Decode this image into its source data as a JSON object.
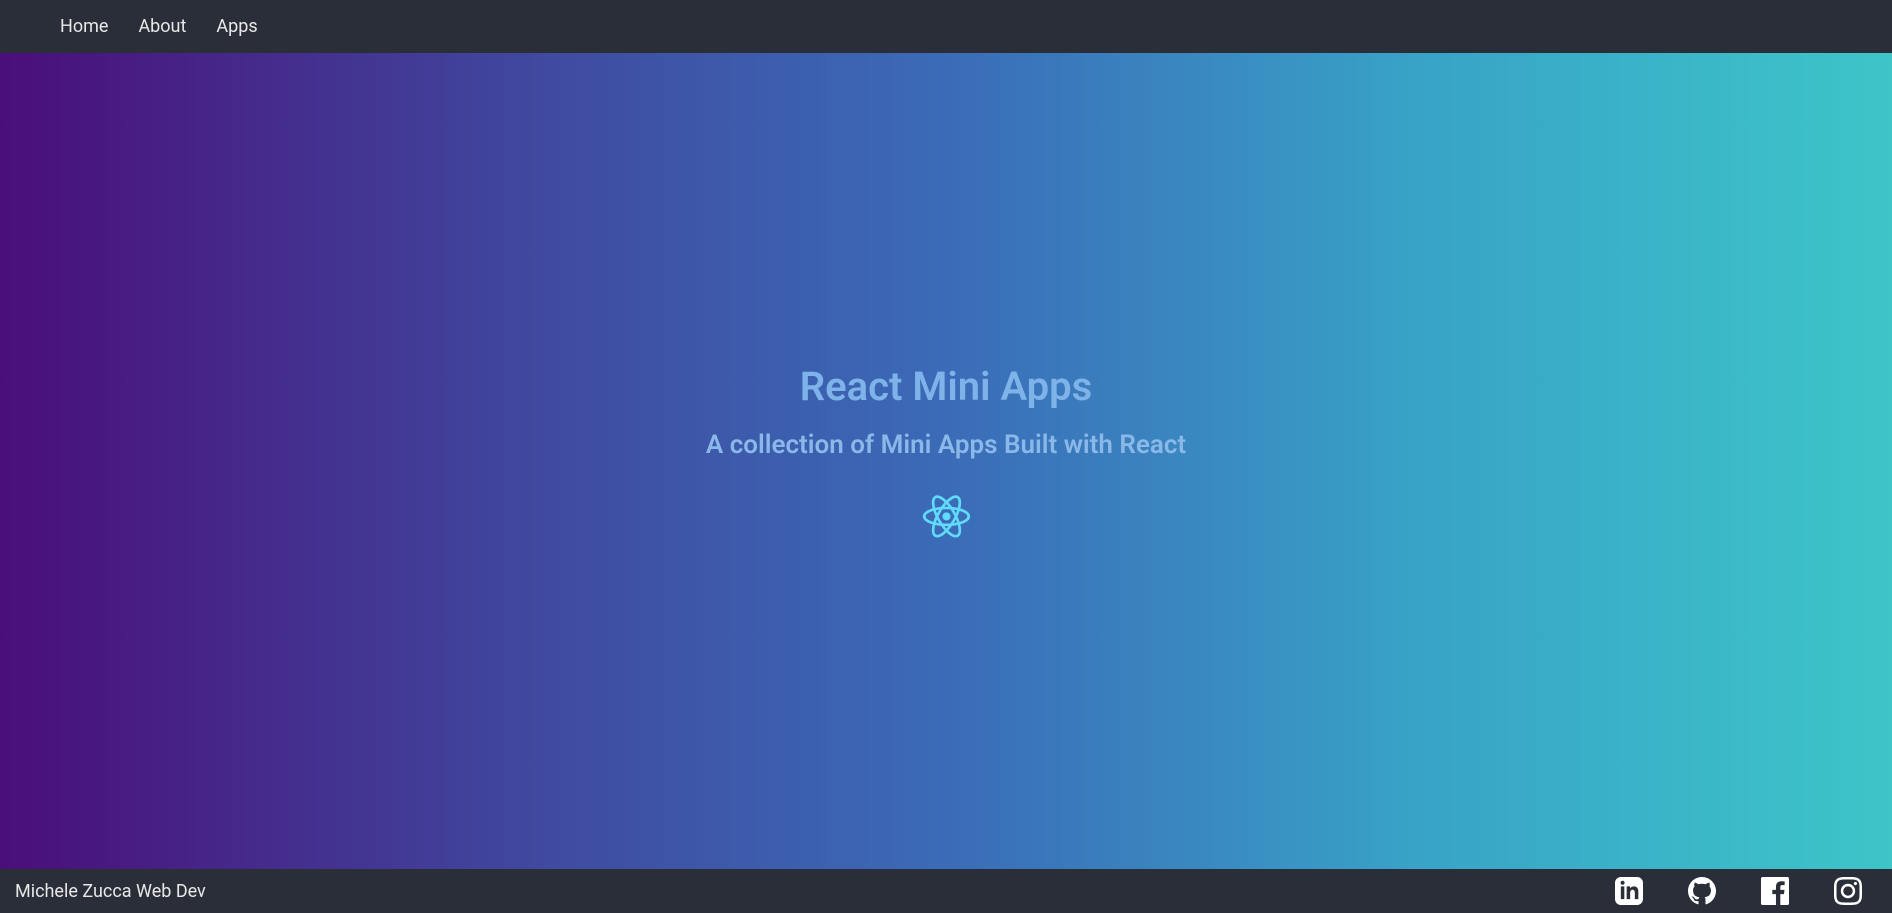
{
  "nav": {
    "home": "Home",
    "about": "About",
    "apps": "Apps"
  },
  "hero": {
    "title": "React Mini Apps",
    "subtitle": "A collection of Mini Apps Built with React"
  },
  "footer": {
    "text": "Michele Zucca Web Dev"
  }
}
